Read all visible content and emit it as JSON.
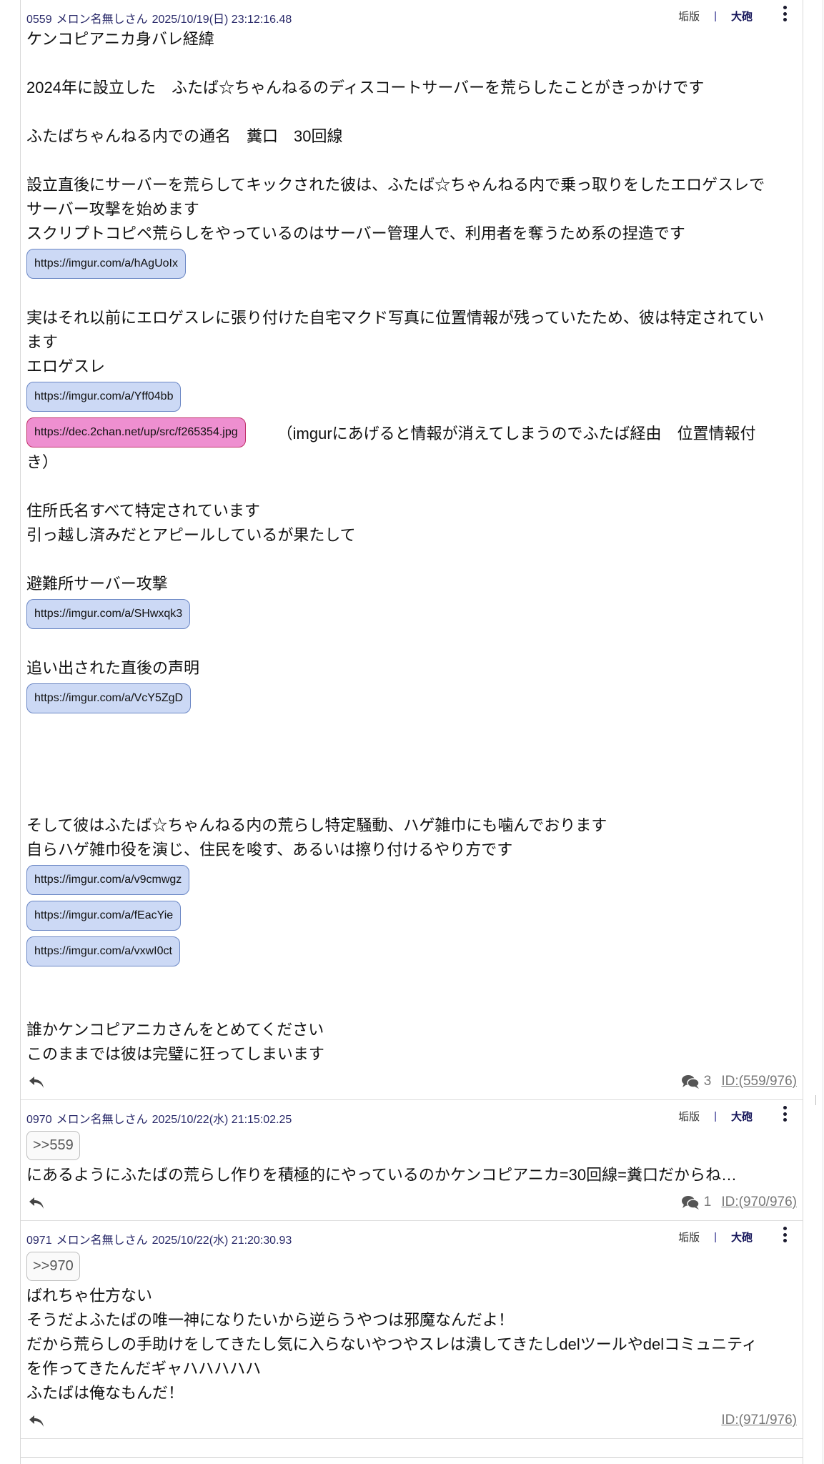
{
  "posts": [
    {
      "number": "0559",
      "name": "メロン名無しさん",
      "date": "2025/10/19(日) 23:12:16.48",
      "tool_gomi": "垢版",
      "tool_sep": "|",
      "tool_taiho": "大砲",
      "lines": {
        "l1": "ケンコピアニカ身バレ経緯",
        "l2": "2024年に設立した　ふたば☆ちゃんねるのディスコートサーバーを荒らしたことがきっかけです",
        "l3": "ふたばちゃんねる内での通名　糞口　30回線",
        "l4": "設立直後にサーバーを荒らしてキックされた彼は、ふたば☆ちゃんねる内で乗っ取りをしたエロゲスレで",
        "l5": "サーバー攻撃を始めます",
        "l6": "スクリプトコピペ荒らしをやっているのはサーバー管理人で、利用者を奪うため系の捏造です",
        "l7": "実はそれ以前にエロゲスレに張り付けた自宅マクド写真に位置情報が残っていたため、彼は特定されてい",
        "l8": "ます",
        "l9": "エロゲスレ",
        "l10_trail": "（imgurにあげると情報が消えてしまうのでふたば経由　位置情報付",
        "l11": "き）",
        "l12": "住所氏名すべて特定されています",
        "l13": "引っ越し済みだとアピールしているが果たして",
        "l14": "避難所サーバー攻撃",
        "l15": "追い出された直後の声明",
        "l16": "そして彼はふたば☆ちゃんねる内の荒らし特定騒動、ハゲ雑巾にも噛んでおります",
        "l17": "自らハゲ雑巾役を演じ、住民を唆す、あるいは擦り付けるやり方です",
        "l18": "誰かケンコピアニカさんをとめてください",
        "l19": "このままでは彼は完璧に狂ってしまいます"
      },
      "links": {
        "a": "https://imgur.com/a/hAgUoIx",
        "b": "https://imgur.com/a/Yff04bb",
        "c": "https://dec.2chan.net/up/src/f265354.jpg",
        "d": "https://imgur.com/a/SHwxqk3",
        "e": "https://imgur.com/a/VcY5ZgD",
        "f": "https://imgur.com/a/v9cmwgz",
        "g": "https://imgur.com/a/fEacYie",
        "h": "https://imgur.com/a/vxwI0ct"
      },
      "reply_count": "3",
      "id_link": "ID:(559/976)"
    },
    {
      "number": "0970",
      "name": "メロン名無しさん",
      "date": "2025/10/22(水) 21:15:02.25",
      "tool_gomi": "垢版",
      "tool_sep": "|",
      "tool_taiho": "大砲",
      "quote": ">>559",
      "lines": {
        "l1": "にあるようにふたばの荒らし作りを積極的にやっているのかケンコピアニカ=30回線=糞口だからね…"
      },
      "reply_count": "1",
      "id_link": "ID:(970/976)"
    },
    {
      "number": "0971",
      "name": "メロン名無しさん",
      "date": "2025/10/22(水) 21:20:30.93",
      "tool_gomi": "垢版",
      "tool_sep": "|",
      "tool_taiho": "大砲",
      "quote": ">>970",
      "lines": {
        "l1": "ばれちゃ仕方ない",
        "l2": "そうだよふたばの唯一神になりたいから逆らうやつは邪魔なんだよ！",
        "l3": "だから荒らしの手助けをしてきたし気に入らないやつやスレは潰してきたしdelツールやdelコミュニティ",
        "l4": "を作ってきたんだギャハハハハハ",
        "l5": "ふたばは俺なもんだ！"
      },
      "id_link": "ID:(971/976)"
    }
  ],
  "icons": {
    "reply": "reply-arrow-icon",
    "comments": "comments-icon",
    "menu": "kebab-menu-icon"
  },
  "colors": {
    "link_pill": "#ccd9f5",
    "image_pill": "#ee8fd0",
    "meta_text": "#2a2a6a"
  }
}
